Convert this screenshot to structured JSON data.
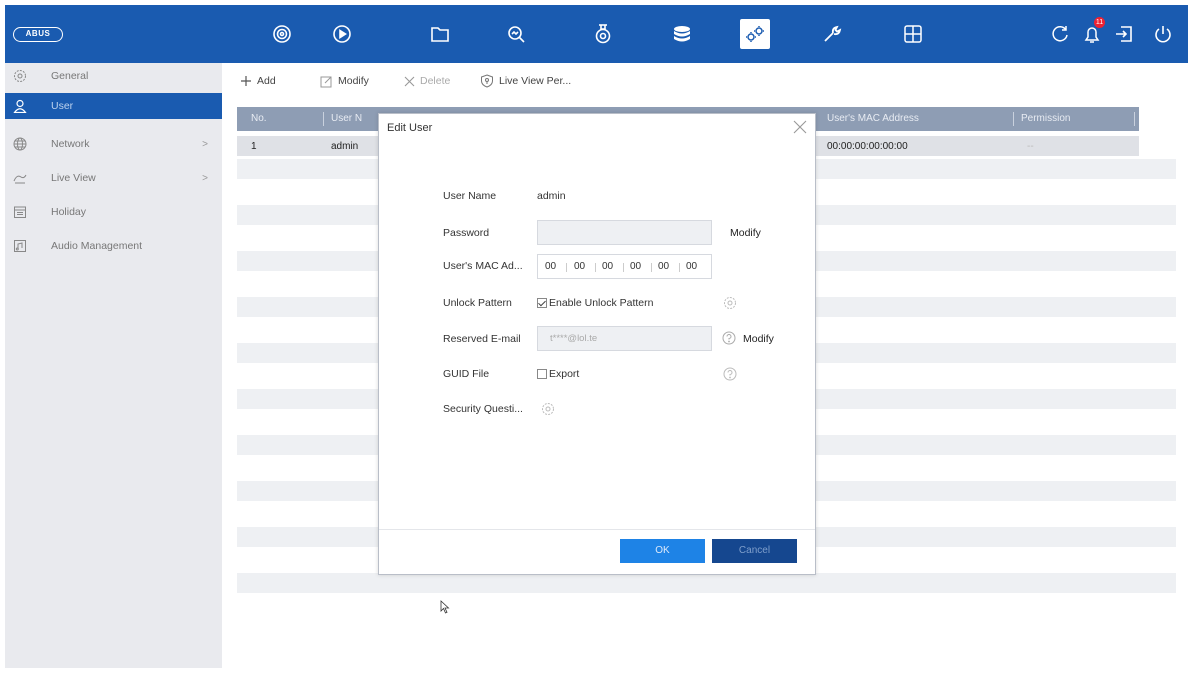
{
  "header": {
    "logo_text": "ABUS",
    "icons": [
      "live-view-icon",
      "playback-icon",
      "file-icon",
      "search-icon",
      "camera-icon",
      "storage-icon",
      "configuration-icon",
      "maintenance-icon",
      "grid-icon",
      "refresh-icon",
      "alarm-icon",
      "logout-icon",
      "power-icon"
    ],
    "alarm_count": "11",
    "accent": "#1a5bb0"
  },
  "sidebar": {
    "items": [
      {
        "label": "General",
        "icon": "gear-icon"
      },
      {
        "label": "User",
        "icon": "user-icon"
      },
      {
        "label": "Network",
        "icon": "globe-icon"
      },
      {
        "label": "Live View",
        "icon": "live-view-icon"
      },
      {
        "label": "Holiday",
        "icon": "calendar-icon"
      },
      {
        "label": "Audio Management",
        "icon": "audio-icon"
      }
    ]
  },
  "toolbar": {
    "add_label": "Add",
    "modify_label": "Modify",
    "delete_label": "Delete",
    "live_view_perm_label": "Live View Per..."
  },
  "table": {
    "headers": {
      "no": "No.",
      "user_name": "User N",
      "mac": "User's MAC Address",
      "permission": "Permission"
    },
    "rows": [
      {
        "no": "1",
        "user_name": "admin",
        "mac": "00:00:00:00:00:00",
        "permission": "--"
      }
    ]
  },
  "dialog": {
    "title": "Edit User",
    "user_name_label": "User Name",
    "user_name_value": "admin",
    "password_label": "Password",
    "password_modify": "Modify",
    "mac_label": "User's MAC Ad...",
    "mac_segments": [
      "00",
      "00",
      "00",
      "00",
      "00",
      "00"
    ],
    "unlock_label": "Unlock Pattern",
    "unlock_checkbox": "Enable Unlock Pattern",
    "unlock_checked": true,
    "email_label": "Reserved E-mail",
    "email_value": "t****@lol.te",
    "email_modify": "Modify",
    "guid_label": "GUID File",
    "guid_checkbox": "Export",
    "guid_checked": false,
    "security_label": "Security Questi...",
    "ok_label": "OK",
    "cancel_label": "Cancel"
  }
}
